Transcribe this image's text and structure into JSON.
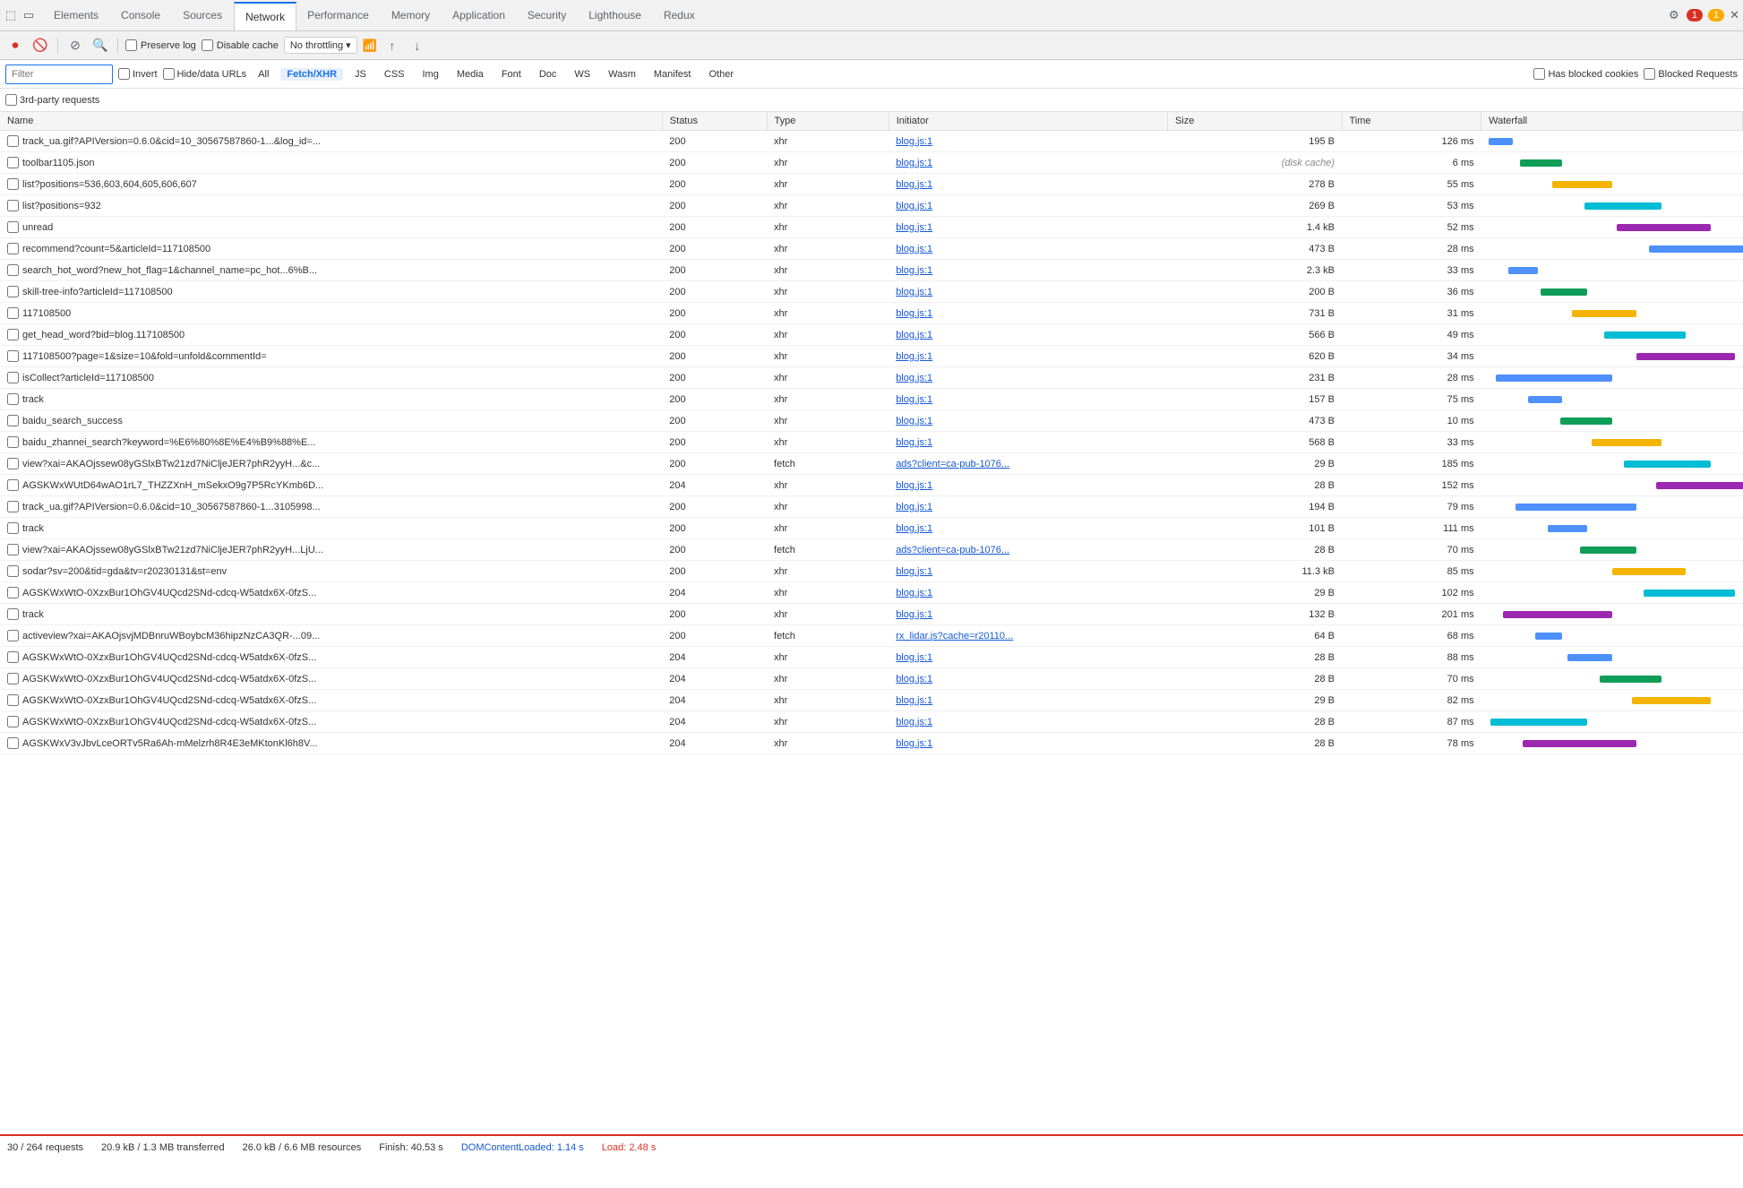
{
  "tabs": {
    "items": [
      {
        "label": "Elements",
        "active": false
      },
      {
        "label": "Console",
        "active": false
      },
      {
        "label": "Sources",
        "active": false
      },
      {
        "label": "Network",
        "active": true
      },
      {
        "label": "Performance",
        "active": false
      },
      {
        "label": "Memory",
        "active": false
      },
      {
        "label": "Application",
        "active": false
      },
      {
        "label": "Security",
        "active": false
      },
      {
        "label": "Lighthouse",
        "active": false
      },
      {
        "label": "Redux",
        "active": false
      }
    ],
    "error_count": "1",
    "warn_count": "1"
  },
  "toolbar": {
    "preserve_log_label": "Preserve log",
    "disable_cache_label": "Disable cache",
    "no_throttling_label": "No throttling"
  },
  "filter": {
    "placeholder": "Filter",
    "invert_label": "Invert",
    "hide_data_urls_label": "Hide/data URLs",
    "types": [
      "All",
      "Fetch/XHR",
      "JS",
      "CSS",
      "Img",
      "Media",
      "Font",
      "Doc",
      "WS",
      "Wasm",
      "Manifest",
      "Other"
    ],
    "active_type": "Fetch/XHR",
    "has_blocked_label": "Has blocked cookies",
    "blocked_requests_label": "Blocked Requests",
    "third_party_label": "3rd-party requests"
  },
  "table": {
    "headers": [
      "Name",
      "Status",
      "Type",
      "Initiator",
      "Size",
      "Time",
      "Waterfall"
    ],
    "rows": [
      {
        "name": "track_ua.gif?APIVersion=0.6.0&cid=10_30567587860-1...&log_id=...",
        "status": "200",
        "type": "xhr",
        "initiator": "blog.js:1",
        "size": "195 B",
        "time": "126 ms"
      },
      {
        "name": "toolbar1105.json",
        "status": "200",
        "type": "xhr",
        "initiator": "blog.js:1",
        "size": "(disk cache)",
        "time": "6 ms",
        "disk_cache": true
      },
      {
        "name": "list?positions=536,603,604,605,606,607",
        "status": "200",
        "type": "xhr",
        "initiator": "blog.js:1",
        "size": "278 B",
        "time": "55 ms"
      },
      {
        "name": "list?positions=932",
        "status": "200",
        "type": "xhr",
        "initiator": "blog.js:1",
        "size": "269 B",
        "time": "53 ms"
      },
      {
        "name": "unread",
        "status": "200",
        "type": "xhr",
        "initiator": "blog.js:1",
        "size": "1.4 kB",
        "time": "52 ms"
      },
      {
        "name": "recommend?count=5&articleId=117108500",
        "status": "200",
        "type": "xhr",
        "initiator": "blog.js:1",
        "size": "473 B",
        "time": "28 ms"
      },
      {
        "name": "search_hot_word?new_hot_flag=1&channel_name=pc_hot...6%B...",
        "status": "200",
        "type": "xhr",
        "initiator": "blog.js:1",
        "size": "2.3 kB",
        "time": "33 ms"
      },
      {
        "name": "skill-tree-info?articleId=117108500",
        "status": "200",
        "type": "xhr",
        "initiator": "blog.js:1",
        "size": "200 B",
        "time": "36 ms"
      },
      {
        "name": "117108500",
        "status": "200",
        "type": "xhr",
        "initiator": "blog.js:1",
        "size": "731 B",
        "time": "31 ms"
      },
      {
        "name": "get_head_word?bid=blog.117108500",
        "status": "200",
        "type": "xhr",
        "initiator": "blog.js:1",
        "size": "566 B",
        "time": "49 ms"
      },
      {
        "name": "117108500?page=1&size=10&fold=unfold&commentId=",
        "status": "200",
        "type": "xhr",
        "initiator": "blog.js:1",
        "size": "620 B",
        "time": "34 ms"
      },
      {
        "name": "isCollect?articleId=117108500",
        "status": "200",
        "type": "xhr",
        "initiator": "blog.js:1",
        "size": "231 B",
        "time": "28 ms"
      },
      {
        "name": "track",
        "status": "200",
        "type": "xhr",
        "initiator": "blog.js:1",
        "size": "157 B",
        "time": "75 ms"
      },
      {
        "name": "baidu_search_success",
        "status": "200",
        "type": "xhr",
        "initiator": "blog.js:1",
        "size": "473 B",
        "time": "10 ms"
      },
      {
        "name": "baidu_zhannei_search?keyword=%E6%80%8E%E4%B9%88%E...",
        "status": "200",
        "type": "xhr",
        "initiator": "blog.js:1",
        "size": "568 B",
        "time": "33 ms"
      },
      {
        "name": "view?xai=AKAOjssew08yGSlxBTw21zd7NiCljeJER7phR2yyH...&c...",
        "status": "200",
        "type": "fetch",
        "initiator": "ads?client=ca-pub-1076...",
        "size": "29 B",
        "time": "185 ms"
      },
      {
        "name": "AGSKWxWUtD64wAO1rL7_THZZXnH_mSekxO9g7P5RcYKmb6D...",
        "status": "204",
        "type": "xhr",
        "initiator": "blog.js:1",
        "size": "28 B",
        "time": "152 ms"
      },
      {
        "name": "track_ua.gif?APIVersion=0.6.0&cid=10_30567587860-1...3105998...",
        "status": "200",
        "type": "xhr",
        "initiator": "blog.js:1",
        "size": "194 B",
        "time": "79 ms"
      },
      {
        "name": "track",
        "status": "200",
        "type": "xhr",
        "initiator": "blog.js:1",
        "size": "101 B",
        "time": "111 ms"
      },
      {
        "name": "view?xai=AKAOjssew08yGSlxBTw21zd7NiCljeJER7phR2yyH...LjU...",
        "status": "200",
        "type": "fetch",
        "initiator": "ads?client=ca-pub-1076...",
        "size": "28 B",
        "time": "70 ms"
      },
      {
        "name": "sodar?sv=200&tid=gda&tv=r20230131&st=env",
        "status": "200",
        "type": "xhr",
        "initiator": "blog.js:1",
        "size": "11.3 kB",
        "time": "85 ms"
      },
      {
        "name": "AGSKWxWtO-0XzxBur1OhGV4UQcd2SNd-cdcq-W5atdx6X-0fzS...",
        "status": "204",
        "type": "xhr",
        "initiator": "blog.js:1",
        "size": "29 B",
        "time": "102 ms"
      },
      {
        "name": "track",
        "status": "200",
        "type": "xhr",
        "initiator": "blog.js:1",
        "size": "132 B",
        "time": "201 ms"
      },
      {
        "name": "activeview?xai=AKAOjsvjMDBnruWBoybcM36hipzNzCA3QR-...09...",
        "status": "200",
        "type": "fetch",
        "initiator": "rx_lidar.js?cache=r20110...",
        "size": "64 B",
        "time": "68 ms"
      },
      {
        "name": "AGSKWxWtO-0XzxBur1OhGV4UQcd2SNd-cdcq-W5atdx6X-0fzS...",
        "status": "204",
        "type": "xhr",
        "initiator": "blog.js:1",
        "size": "28 B",
        "time": "88 ms"
      },
      {
        "name": "AGSKWxWtO-0XzxBur1OhGV4UQcd2SNd-cdcq-W5atdx6X-0fzS...",
        "status": "204",
        "type": "xhr",
        "initiator": "blog.js:1",
        "size": "28 B",
        "time": "70 ms"
      },
      {
        "name": "AGSKWxWtO-0XzxBur1OhGV4UQcd2SNd-cdcq-W5atdx6X-0fzS...",
        "status": "204",
        "type": "xhr",
        "initiator": "blog.js:1",
        "size": "29 B",
        "time": "82 ms"
      },
      {
        "name": "AGSKWxWtO-0XzxBur1OhGV4UQcd2SNd-cdcq-W5atdx6X-0fzS...",
        "status": "204",
        "type": "xhr",
        "initiator": "blog.js:1",
        "size": "28 B",
        "time": "87 ms"
      },
      {
        "name": "AGSKWxV3vJbvLceORTv5Ra6Ah-mMelzrh8R4E3eMKtonKl6h8V...",
        "status": "204",
        "type": "xhr",
        "initiator": "blog.js:1",
        "size": "28 B",
        "time": "78 ms"
      }
    ]
  },
  "status_bar": {
    "requests": "30 / 264 requests",
    "transferred": "20.9 kB / 1.3 MB transferred",
    "resources": "26.0 kB / 6.6 MB resources",
    "finish": "Finish: 40.53 s",
    "dom_content_loaded": "DOMContentLoaded: 1.14 s",
    "load": "Load: 2.48 s"
  },
  "waterfall_colors": {
    "blue": "#4d90fe",
    "green": "#0f9d58",
    "orange": "#f4b400",
    "teal": "#00bcd4"
  }
}
